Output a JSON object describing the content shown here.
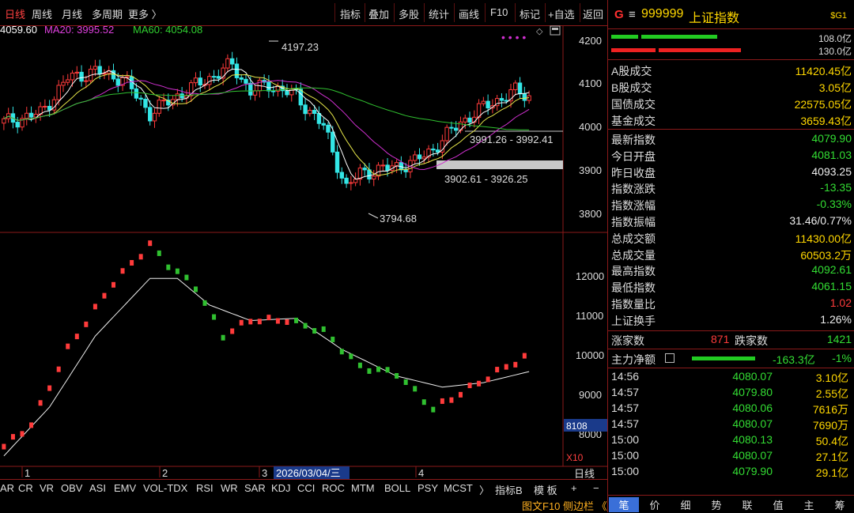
{
  "toolbar": {
    "periods": [
      "日线",
      "周线",
      "月线",
      "多周期",
      "更多 〉"
    ],
    "buttons": [
      "指标",
      "叠加",
      "多股",
      "统计",
      "画线",
      "F10",
      "标记",
      "+自选",
      "返回"
    ]
  },
  "ma_labels": {
    "ma_partial": "4059.60",
    "ma20": "MA20: 3995.52",
    "ma60": "MA60: 4054.08"
  },
  "colors": {
    "up": "#ff3b3b",
    "down": "#33e6e6",
    "ma5": "#ffffff",
    "ma10": "#e8e84a",
    "ma20": "#d030d0",
    "ma60": "#30c030",
    "grid_line": "#8b1a1a"
  },
  "chart_data": [
    {
      "type": "candlestick",
      "price_axis": [
        "4200",
        "4100",
        "4000",
        "3900",
        "3800"
      ],
      "annotations": [
        "4197.23",
        "3991.26 - 3992.41",
        "3902.61 - 3926.25",
        "3794.68"
      ],
      "ylim": [
        3770,
        4240
      ]
    },
    {
      "type": "line",
      "indicator_axis": [
        "12000",
        "11000",
        "10000",
        "9000",
        "8000"
      ],
      "axis_box": "8108",
      "scale_label": "X10",
      "ylim": [
        7700,
        12900
      ]
    }
  ],
  "month_markers": [
    "1",
    "2",
    "3",
    "4"
  ],
  "selected_date": "2026/03/04/三",
  "period_label": "日线",
  "indicator_tabs": [
    "AR",
    "CR",
    "VR",
    "OBV",
    "ASI",
    "EMV",
    "VOL-TDX",
    "RSI",
    "WR",
    "SAR",
    "KDJ",
    "CCI",
    "ROC",
    "MTM",
    "BOLL",
    "PSY",
    "MCST",
    "〉",
    "指标B",
    "模 板",
    "+",
    "−"
  ],
  "statusbar": {
    "label": "图文F10 侧边栏 《"
  },
  "quote": {
    "code_icon": "G",
    "menu_icon": "≡",
    "code": "999999",
    "name": "上证指数",
    "badge": "$G1",
    "bar1_value": "108.0亿",
    "bar2_value": "130.0亿",
    "volumes": [
      {
        "label": "A股成交",
        "value": "11420.45亿"
      },
      {
        "label": "B股成交",
        "value": "3.05亿"
      },
      {
        "label": "国债成交",
        "value": "22575.05亿"
      },
      {
        "label": "基金成交",
        "value": "3659.43亿"
      }
    ],
    "stats": [
      {
        "label": "最新指数",
        "value": "4079.90",
        "color": "green"
      },
      {
        "label": "今日开盘",
        "value": "4081.03",
        "color": "green"
      },
      {
        "label": "昨日收盘",
        "value": "4093.25",
        "color": "white"
      },
      {
        "label": "指数涨跌",
        "value": "-13.35",
        "color": "green"
      },
      {
        "label": "指数涨幅",
        "value": "-0.33%",
        "color": "green"
      },
      {
        "label": "指数振幅",
        "value": "31.46/0.77%",
        "color": "white"
      },
      {
        "label": "总成交额",
        "value": "11430.00亿",
        "color": "yellow"
      },
      {
        "label": "总成交量",
        "value": "60503.2万",
        "color": "yellow"
      },
      {
        "label": "最高指数",
        "value": "4092.61",
        "color": "green"
      },
      {
        "label": "最低指数",
        "value": "4061.15",
        "color": "green"
      },
      {
        "label": "指数量比",
        "value": "1.02",
        "color": "red"
      },
      {
        "label": "上证换手",
        "value": "1.26%",
        "color": "white"
      }
    ],
    "breadth": {
      "up_label": "涨家数",
      "up_value": "871",
      "down_label": "跌家数",
      "down_value": "1421"
    },
    "main_flow": {
      "label": "主力净额",
      "value": "-163.3亿",
      "pct": "-1%"
    },
    "ticks": [
      {
        "time": "14:56",
        "price": "4080.07",
        "vol": "3.10亿"
      },
      {
        "time": "14:57",
        "price": "4079.80",
        "vol": "2.55亿"
      },
      {
        "time": "14:57",
        "price": "4080.06",
        "vol": "7616万"
      },
      {
        "time": "14:57",
        "price": "4080.07",
        "vol": "7690万"
      },
      {
        "time": "15:00",
        "price": "4080.13",
        "vol": "50.4亿"
      },
      {
        "time": "15:00",
        "price": "4080.07",
        "vol": "27.1亿"
      },
      {
        "time": "15:00",
        "price": "4079.90",
        "vol": "29.1亿"
      }
    ],
    "tabs": [
      "笔",
      "价",
      "细",
      "势",
      "联",
      "值",
      "主",
      "筹"
    ]
  }
}
